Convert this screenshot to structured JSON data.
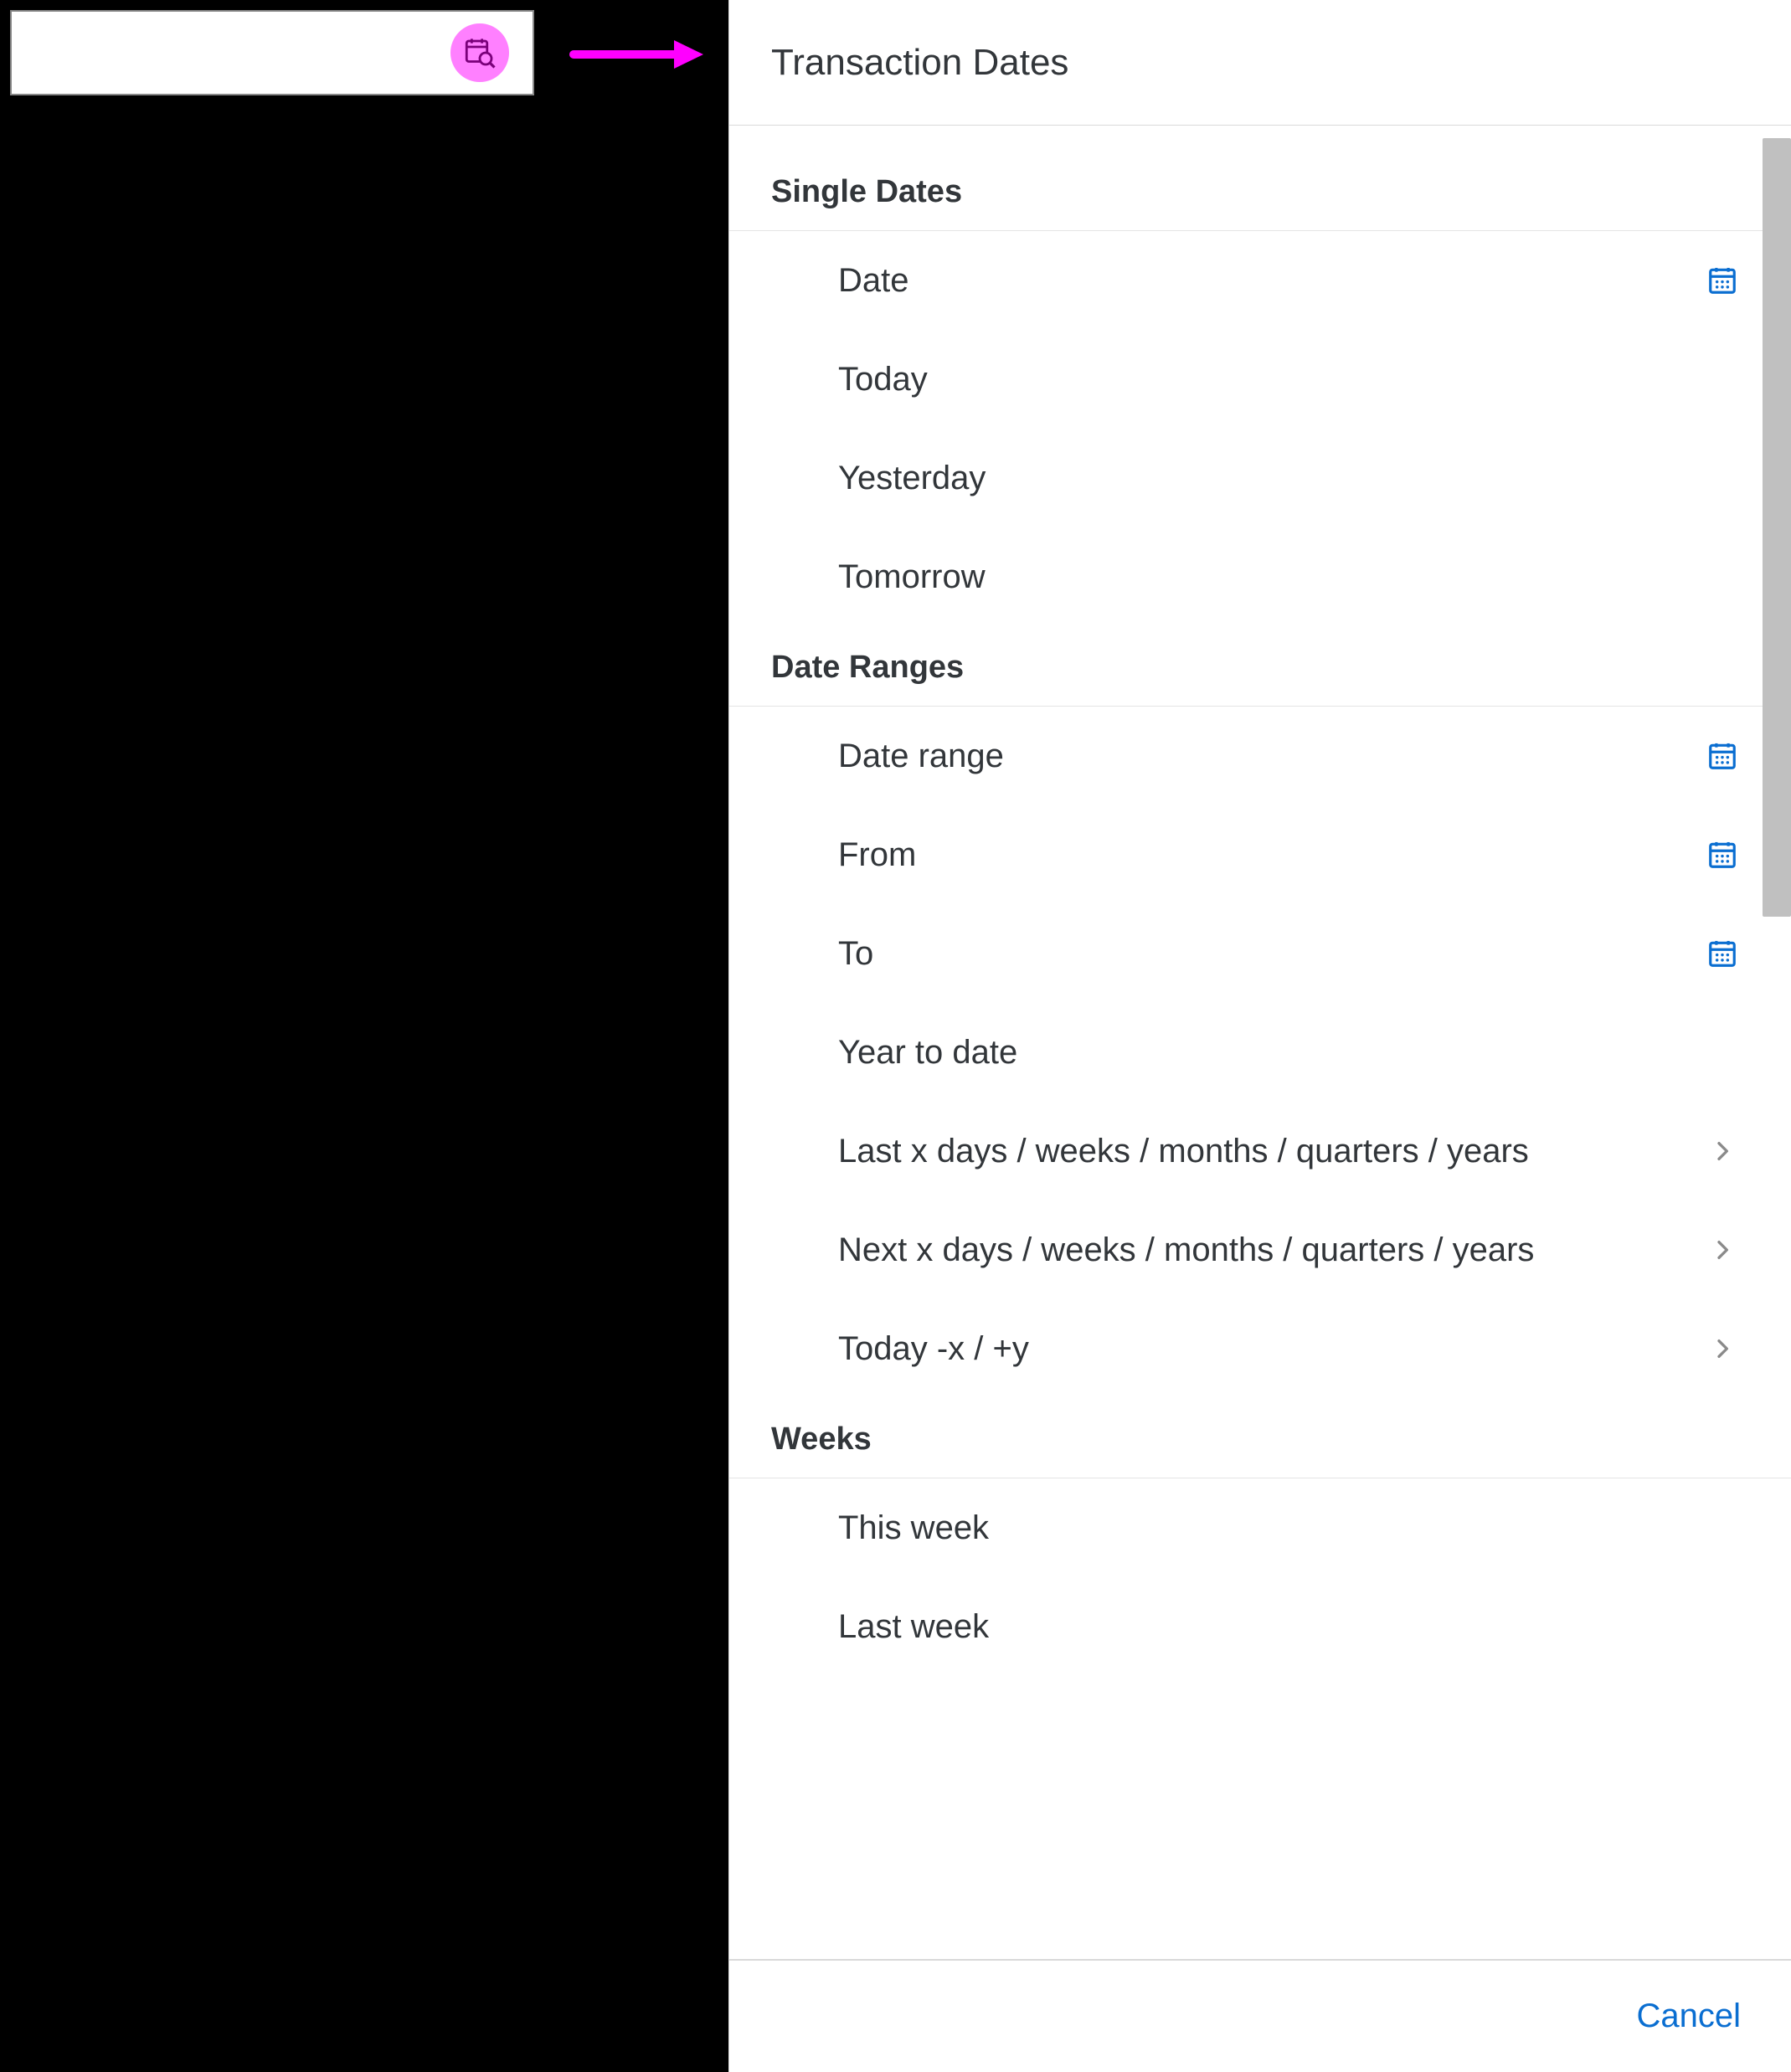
{
  "colors": {
    "accent": "#0a6ed1",
    "highlight": "#ff00ff",
    "iconHighlightBg": "#ff80ff",
    "text": "#32363a"
  },
  "leftField": {
    "placeholder": "",
    "iconName": "calendar-search-icon"
  },
  "arrow": {
    "name": "arrow-right"
  },
  "panel": {
    "title": "Transaction Dates",
    "sections": [
      {
        "header": "Single Dates",
        "items": [
          {
            "label": "Date",
            "trailing": "calendar"
          },
          {
            "label": "Today",
            "trailing": "none"
          },
          {
            "label": "Yesterday",
            "trailing": "none"
          },
          {
            "label": "Tomorrow",
            "trailing": "none"
          }
        ]
      },
      {
        "header": "Date Ranges",
        "items": [
          {
            "label": "Date range",
            "trailing": "calendar"
          },
          {
            "label": "From",
            "trailing": "calendar"
          },
          {
            "label": "To",
            "trailing": "calendar"
          },
          {
            "label": "Year to date",
            "trailing": "none"
          },
          {
            "label": "Last x days / weeks / months / quarters / years",
            "trailing": "chevron"
          },
          {
            "label": "Next x days / weeks / months / quarters / years",
            "trailing": "chevron"
          },
          {
            "label": "Today -x / +y",
            "trailing": "chevron"
          }
        ]
      },
      {
        "header": "Weeks",
        "items": [
          {
            "label": "This week",
            "trailing": "none"
          },
          {
            "label": "Last week",
            "trailing": "none"
          }
        ]
      }
    ],
    "footer": {
      "cancel": "Cancel"
    }
  }
}
